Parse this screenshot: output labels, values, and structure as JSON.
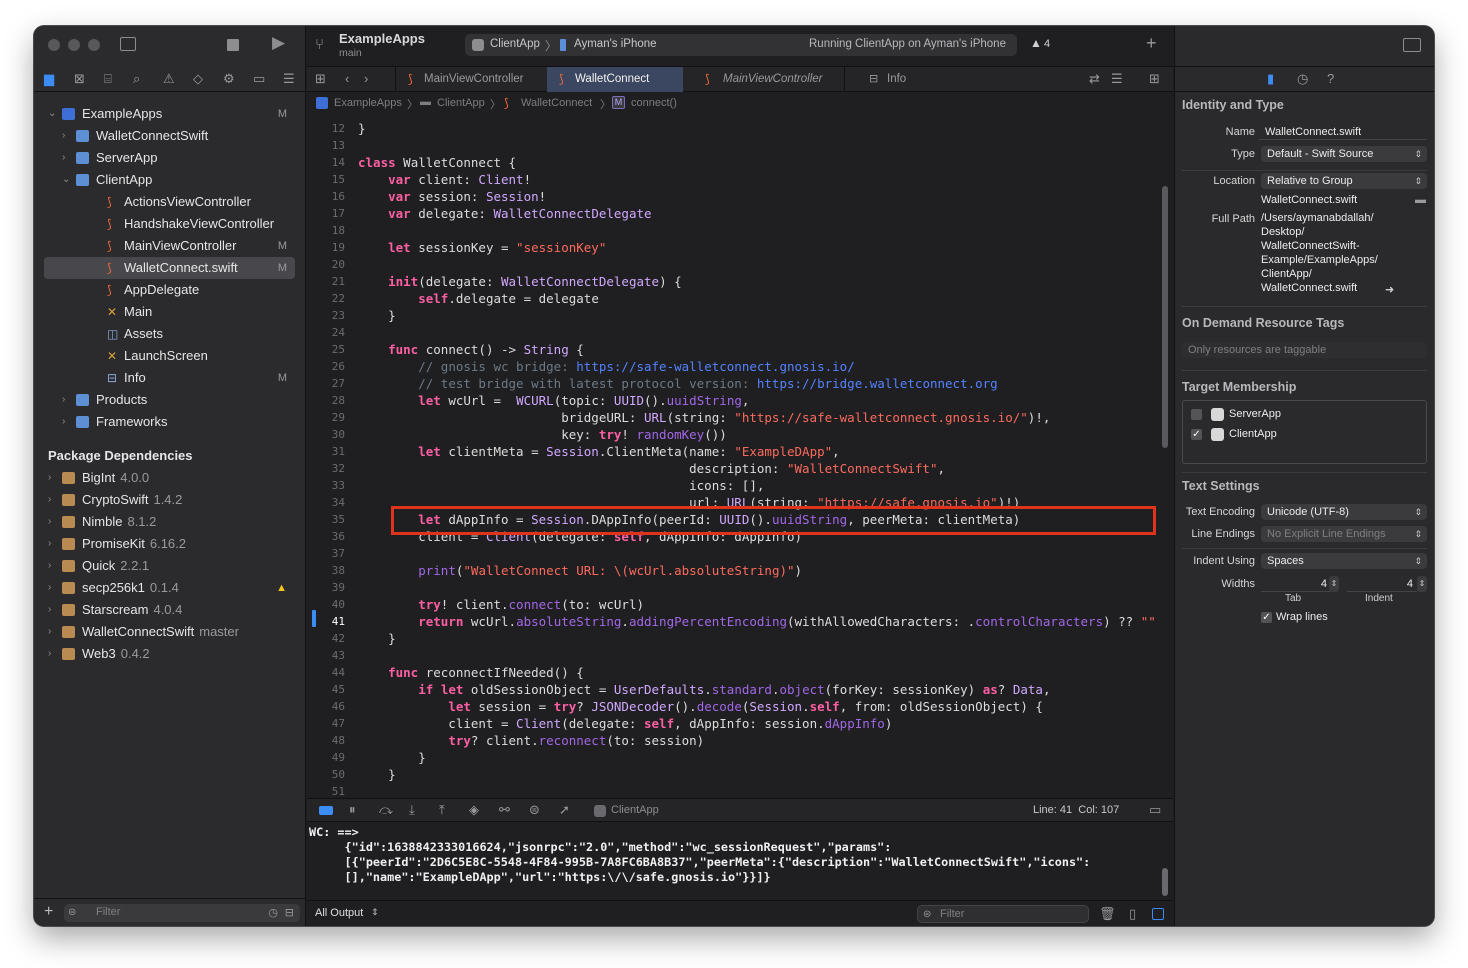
{
  "window": {
    "project": "ExampleApps",
    "branch": "main",
    "scheme": "ClientApp",
    "device": "Ayman's iPhone",
    "status": "Running ClientApp on Ayman's iPhone",
    "warnings": "4"
  },
  "tabs": [
    "MainViewController",
    "WalletConnect",
    "MainViewController",
    "Info"
  ],
  "breadcrumb": [
    "ExampleApps",
    "ClientApp",
    "WalletConnect",
    "connect()"
  ],
  "navigator": {
    "project_items": [
      {
        "label": "ExampleApps",
        "status": "M",
        "kind": "project"
      },
      {
        "label": "WalletConnectSwift",
        "kind": "folder"
      },
      {
        "label": "ServerApp",
        "kind": "folder"
      },
      {
        "label": "ClientApp",
        "kind": "folder"
      },
      {
        "label": "ActionsViewController",
        "kind": "swift"
      },
      {
        "label": "HandshakeViewController",
        "kind": "swift"
      },
      {
        "label": "MainViewController",
        "status": "M",
        "kind": "swift"
      },
      {
        "label": "WalletConnect.swift",
        "status": "M",
        "kind": "swift"
      },
      {
        "label": "AppDelegate",
        "kind": "swift"
      },
      {
        "label": "Main",
        "kind": "storyboard"
      },
      {
        "label": "Assets",
        "kind": "assets"
      },
      {
        "label": "LaunchScreen",
        "kind": "storyboard"
      },
      {
        "label": "Info",
        "status": "M",
        "kind": "plist"
      },
      {
        "label": "Products",
        "kind": "folder"
      },
      {
        "label": "Frameworks",
        "kind": "folder"
      }
    ],
    "packages_title": "Package Dependencies",
    "packages": [
      {
        "name": "BigInt",
        "version": "4.0.0"
      },
      {
        "name": "CryptoSwift",
        "version": "1.4.2"
      },
      {
        "name": "Nimble",
        "version": "8.1.2"
      },
      {
        "name": "PromiseKit",
        "version": "6.16.2"
      },
      {
        "name": "Quick",
        "version": "2.2.1"
      },
      {
        "name": "secp256k1",
        "version": "0.1.4"
      },
      {
        "name": "Starscream",
        "version": "4.0.4"
      },
      {
        "name": "WalletConnectSwift",
        "version": "master"
      },
      {
        "name": "Web3",
        "version": "0.4.2"
      }
    ],
    "filter_placeholder": "Filter"
  },
  "code": {
    "lines": [
      {
        "n": 12,
        "c": "}"
      },
      {
        "n": 13,
        "c": ""
      },
      {
        "n": 14,
        "c": "class WalletConnect {"
      },
      {
        "n": 15,
        "c": "    var client: Client!"
      },
      {
        "n": 16,
        "c": "    var session: Session!"
      },
      {
        "n": 17,
        "c": "    var delegate: WalletConnectDelegate"
      },
      {
        "n": 18,
        "c": ""
      },
      {
        "n": 19,
        "c": "    let sessionKey = \"sessionKey\""
      },
      {
        "n": 20,
        "c": ""
      },
      {
        "n": 21,
        "c": "    init(delegate: WalletConnectDelegate) {"
      },
      {
        "n": 22,
        "c": "        self.delegate = delegate"
      },
      {
        "n": 23,
        "c": "    }"
      },
      {
        "n": 24,
        "c": ""
      },
      {
        "n": 25,
        "c": "    func connect() -> String {"
      },
      {
        "n": 26,
        "c": "        // gnosis wc bridge: https://safe-walletconnect.gnosis.io/"
      },
      {
        "n": 27,
        "c": "        // test bridge with latest protocol version: https://bridge.walletconnect.org"
      },
      {
        "n": 28,
        "c": "        let wcUrl =  WCURL(topic: UUID().uuidString,"
      },
      {
        "n": 29,
        "c": "                           bridgeURL: URL(string: \"https://safe-walletconnect.gnosis.io/\")!,"
      },
      {
        "n": 30,
        "c": "                           key: try! randomKey())"
      },
      {
        "n": 31,
        "c": "        let clientMeta = Session.ClientMeta(name: \"ExampleDApp\","
      },
      {
        "n": 32,
        "c": "                                            description: \"WalletConnectSwift\","
      },
      {
        "n": 33,
        "c": "                                            icons: [],"
      },
      {
        "n": 34,
        "c": "                                            url: URL(string: \"https://safe.gnosis.io\")!)"
      },
      {
        "n": 35,
        "c": "        let dAppInfo = Session.DAppInfo(peerId: UUID().uuidString, peerMeta: clientMeta)"
      },
      {
        "n": 36,
        "c": "        client = Client(delegate: self, dAppInfo: dAppInfo)"
      },
      {
        "n": 37,
        "c": ""
      },
      {
        "n": 38,
        "c": "        print(\"WalletConnect URL: \\(wcUrl.absoluteString)\")"
      },
      {
        "n": 39,
        "c": ""
      },
      {
        "n": 40,
        "c": "        try! client.connect(to: wcUrl)"
      },
      {
        "n": 41,
        "c": "        return wcUrl.absoluteString.addingPercentEncoding(withAllowedCharacters: .controlCharacters) ?? \"\""
      },
      {
        "n": 42,
        "c": "    }"
      },
      {
        "n": 43,
        "c": ""
      },
      {
        "n": 44,
        "c": "    func reconnectIfNeeded() {"
      },
      {
        "n": 45,
        "c": "        if let oldSessionObject = UserDefaults.standard.object(forKey: sessionKey) as? Data,"
      },
      {
        "n": 46,
        "c": "            let session = try? JSONDecoder().decode(Session.self, from: oldSessionObject) {"
      },
      {
        "n": 47,
        "c": "            client = Client(delegate: self, dAppInfo: session.dAppInfo)"
      },
      {
        "n": 48,
        "c": "            try? client.reconnect(to: session)"
      },
      {
        "n": 49,
        "c": "        }"
      },
      {
        "n": 50,
        "c": "    }"
      },
      {
        "n": 51,
        "c": ""
      }
    ]
  },
  "debug_bar": {
    "target": "ClientApp",
    "position": "Line: 41  Col: 107"
  },
  "console": {
    "text": "WC: ==>\n     {\"id\":1638842333016624,\"jsonrpc\":\"2.0\",\"method\":\"wc_sessionRequest\",\"params\":\n     [{\"peerId\":\"2D6C5E8C-5548-4F84-995B-7A8FC6BA8B37\",\"peerMeta\":{\"description\":\"WalletConnectSwift\",\"icons\":\n     [],\"name\":\"ExampleDApp\",\"url\":\"https:\\/\\/safe.gnosis.io\"}}]}",
    "output_selector": "All Output",
    "filter_placeholder": "Filter"
  },
  "inspector": {
    "identity_title": "Identity and Type",
    "name_label": "Name",
    "name_value": "WalletConnect.swift",
    "type_label": "Type",
    "type_value": "Default - Swift Source",
    "location_label": "Location",
    "location_value": "Relative to Group",
    "location_file": "WalletConnect.swift",
    "fullpath_label": "Full Path",
    "fullpath": [
      "/Users/aymanabdallah/",
      "Desktop/",
      "WalletConnectSwift-",
      "Example/ExampleApps/",
      "ClientApp/",
      "WalletConnect.swift"
    ],
    "ondemand_title": "On Demand Resource Tags",
    "ondemand_placeholder": "Only resources are taggable",
    "membership_title": "Target Membership",
    "targets": [
      {
        "name": "ServerApp",
        "checked": false
      },
      {
        "name": "ClientApp",
        "checked": true
      }
    ],
    "text_settings_title": "Text Settings",
    "encoding_label": "Text Encoding",
    "encoding_value": "Unicode (UTF-8)",
    "endings_label": "Line Endings",
    "endings_value": "No Explicit Line Endings",
    "indent_label": "Indent Using",
    "indent_value": "Spaces",
    "widths_label": "Widths",
    "tab_width": "4",
    "indent_width": "4",
    "tab_caption": "Tab",
    "indent_caption": "Indent",
    "wrap_label": "Wrap lines",
    "wrap_checked": true
  },
  "colors": {
    "highlight_box": "#e0331c",
    "keyword": "#fc5fa3",
    "string": "#fc6a5d",
    "comment": "#6c7986",
    "swift_icon": "#f06a3a"
  }
}
